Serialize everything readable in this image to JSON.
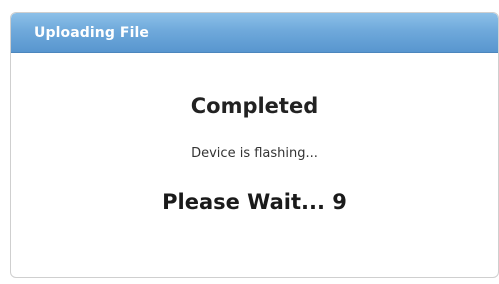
{
  "dialog": {
    "title": "Uploading File",
    "status_heading": "Completed",
    "status_message": "Device is flashing...",
    "wait_label": "Please Wait...",
    "countdown": "9"
  },
  "colors": {
    "titlebar_accent": "#6fa9db",
    "title_text": "#ffffff",
    "body_text": "#222222"
  }
}
